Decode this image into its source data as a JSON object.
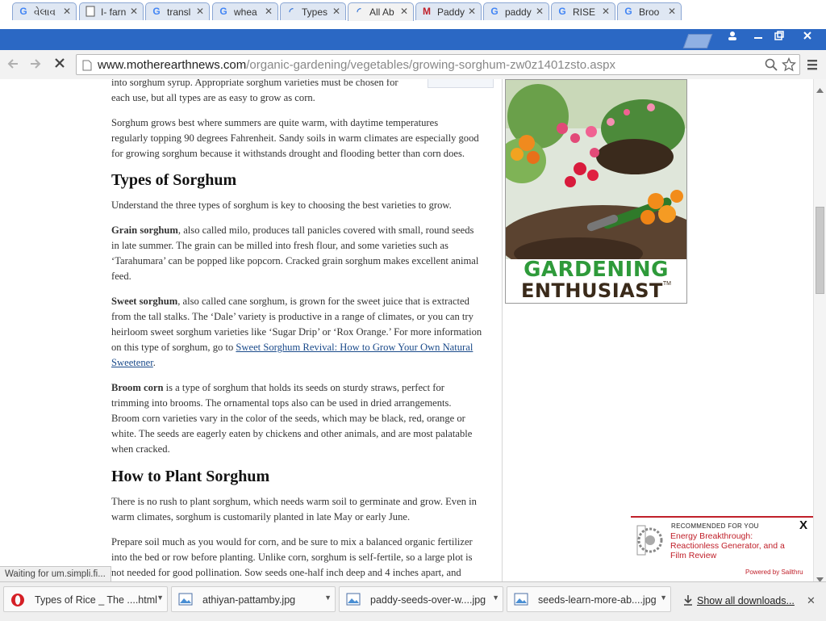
{
  "browser": {
    "tabs": [
      {
        "icon": "google-g-icon",
        "title": "વેલાવ"
      },
      {
        "icon": "document-icon",
        "title": "I- farn"
      },
      {
        "icon": "google-g-icon",
        "title": "transl"
      },
      {
        "icon": "google-g-icon",
        "title": "whea"
      },
      {
        "icon": "loading-icon",
        "title": "Types"
      },
      {
        "icon": "loading-icon",
        "title": "All Ab"
      },
      {
        "icon": "mother-earth-icon",
        "title": "Paddy"
      },
      {
        "icon": "google-g-icon",
        "title": "paddy"
      },
      {
        "icon": "google-g-icon",
        "title": "RISE"
      },
      {
        "icon": "google-g-icon",
        "title": "Broo"
      }
    ],
    "tab_close": "✕",
    "url_domain": "www.motherearthnews.com",
    "url_path": "/organic-gardening/vegetables/growing-sorghum-zw0z1401zsto.aspx",
    "status_text": "Waiting for um.simpli.fi..."
  },
  "article": {
    "intro_lines": [
      "into sorghum syrup. Appropriate sorghum varieties must be chosen for",
      "each use, but all types are as easy to grow as corn."
    ],
    "p_climate_lines": [
      "Sorghum grows best where summers are quite warm, with daytime temperatures",
      "regularly topping 90 degrees Fahrenheit. Sandy soils in warm climates are especially good",
      "for growing sorghum because it withstands drought and flooding better than corn does."
    ],
    "h_types": "Types of Sorghum",
    "p_understand": "Understand the three types of sorghum is key to choosing the best varieties to grow.",
    "grain_bold": "Grain sorghum",
    "grain_lines": [
      ", also called milo, produces tall panicles covered with small, round seeds",
      "in late summer. The grain can be milled into fresh flour, and some varieties such as",
      "‘Tarahumara’ can be popped like popcorn. Cracked grain sorghum makes excellent animal",
      "feed."
    ],
    "sweet_bold": "Sweet sorghum",
    "sweet_lines": [
      ", also called cane sorghum, is grown for the sweet juice that is extracted",
      "from the tall stalks. The ‘Dale’ variety is productive in a range of climates, or you can try",
      "heirloom sweet sorghum varieties like ‘Sugar Drip’ or ‘Rox Orange.’ For more information",
      "on this type of sorghum, go to "
    ],
    "sweet_link_1": "Sweet Sorghum Revival: How to Grow Your Own Natural",
    "sweet_link_2": "Sweetener",
    "broom_bold": "Broom corn",
    "broom_lines": [
      " is a type of sorghum that holds its seeds on sturdy straws, perfect for",
      "trimming into brooms. The ornamental tops also can be used in dried arrangements.",
      "Broom corn varieties vary in the color of the seeds, which may be black, red, orange or",
      "white. The seeds are eagerly eaten by chickens and other animals, and are most palatable",
      "when cracked."
    ],
    "h_plant": "How to Plant Sorghum",
    "plant_lines": [
      "There is no rush to plant sorghum, which needs warm soil to germinate and grow. Even in",
      "warm climates, sorghum is customarily planted in late May or early June."
    ],
    "prepare_lines": [
      "Prepare soil much as you would for corn, and be sure to mix a balanced organic fertilizer",
      "into the bed or row before planting. Unlike corn, sorghum is self-fertile, so a large plot is",
      "not needed for good pollination. Sow seeds one-half inch deep and 4 inches apart, and"
    ]
  },
  "ad": {
    "line1": "GARDENING",
    "line2": "ENTHUSIAST",
    "tm": "TM"
  },
  "recommended": {
    "heading": "RECOMMENDED FOR YOU",
    "close": "X",
    "link": "Energy Breakthrough: Reactionless Generator, and a Film Review",
    "powered": "Powered by Sailthru"
  },
  "downloads": {
    "items": [
      {
        "name": "Types of Rice _ The ....html",
        "icon": "opera-icon"
      },
      {
        "name": "athiyan-pattamby.jpg",
        "icon": "image-file-icon"
      },
      {
        "name": "paddy-seeds-over-w....jpg",
        "icon": "image-file-icon"
      },
      {
        "name": "seeds-learn-more-ab....jpg",
        "icon": "image-file-icon"
      }
    ],
    "show_all": "Show all downloads...",
    "close": "✕"
  },
  "colors": {
    "tabstrip": "#2b68c4",
    "link": "#1a4a8a",
    "ad_green": "#2e9a3a",
    "ad_dark": "#3a2a1a",
    "rec_red": "#c0202a"
  }
}
